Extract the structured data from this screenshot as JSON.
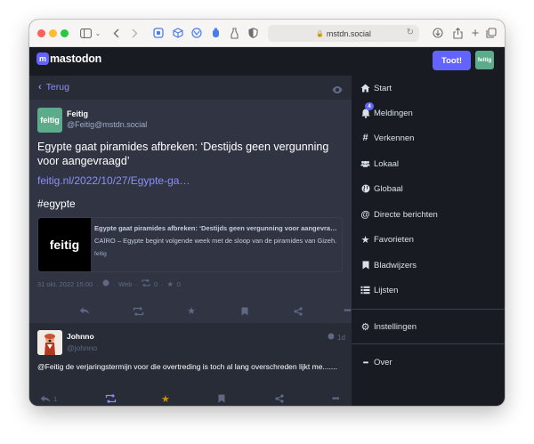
{
  "browser": {
    "url": "mstdn.social"
  },
  "header": {
    "logo_text": "mastodon",
    "toot_label": "Toot!",
    "avatar_label": "feitig"
  },
  "column": {
    "back_label": "Terug"
  },
  "status": {
    "avatar_label": "feitig",
    "display_name": "Feitig",
    "handle": "@Feitig@mstdn.social",
    "text": "Egypte gaat piramides afbreken: ‘Destijds geen vergunning voor aangevraagd’",
    "link": "feitig.nl/2022/10/27/Egypte-ga…",
    "hashtag": "#egypte",
    "card": {
      "thumb_label": "feitig",
      "title": "Egypte gaat piramides afbreken: ‘Destijds geen vergunning voor aangevraagd’",
      "description": "CAÏRO – Egypte begint volgende week met de sloop van de piramides van Gizeh.",
      "domain": "feitig"
    },
    "meta": {
      "date": "31 okt. 2022 15:00",
      "separator": "·",
      "app": "Web",
      "boosts": "0",
      "favourites": "0"
    }
  },
  "reply": {
    "display_name": "Johnno",
    "handle": "@johnno",
    "time": "1d",
    "text": "@Feitig de verjaringstermijn voor die overtreding is toch al lang overschreden lijkt me.......",
    "reply_count": "1"
  },
  "nav": {
    "items": [
      {
        "label": "Start",
        "icon": "home-icon"
      },
      {
        "label": "Meldingen",
        "icon": "bell-icon",
        "badge": "4"
      },
      {
        "label": "Verkennen",
        "icon": "hashtag-icon"
      },
      {
        "label": "Lokaal",
        "icon": "users-icon"
      },
      {
        "label": "Globaal",
        "icon": "globe-icon"
      },
      {
        "label": "Directe berichten",
        "icon": "at-icon"
      },
      {
        "label": "Favorieten",
        "icon": "star-icon"
      },
      {
        "label": "Bladwijzers",
        "icon": "bookmark-icon"
      },
      {
        "label": "Lijsten",
        "icon": "list-icon"
      },
      {
        "label": "Instellingen",
        "icon": "gear-icon"
      },
      {
        "label": "Over",
        "icon": "ellipsis-icon"
      }
    ]
  },
  "colors": {
    "accent": "#6364ff",
    "link": "#8c8dff",
    "favourite_active": "#ca8f04",
    "boost_active": "#8c8dff"
  }
}
